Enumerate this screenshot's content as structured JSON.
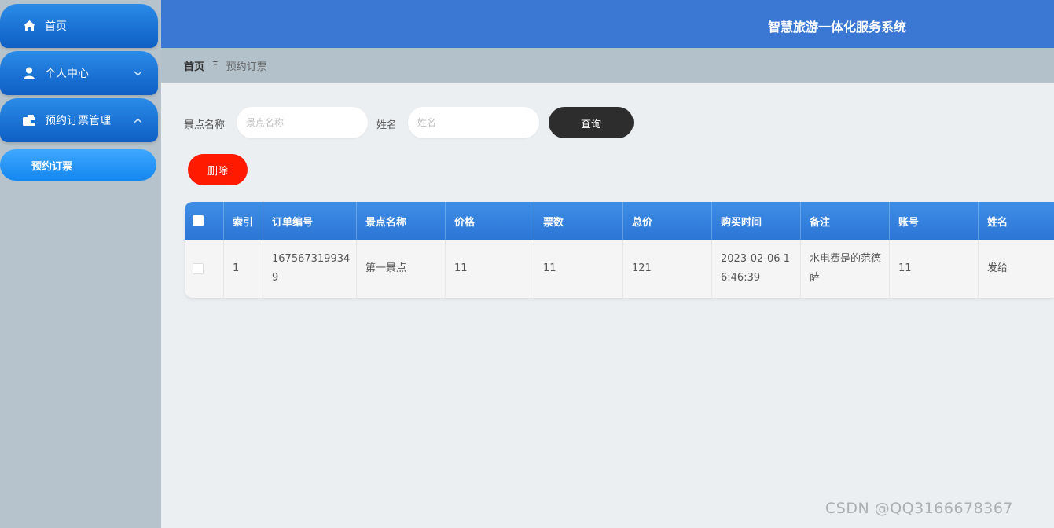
{
  "app": {
    "title": "智慧旅游一体化服务系统"
  },
  "sidebar": {
    "items": [
      {
        "label": "首页",
        "icon": "home-icon"
      },
      {
        "label": "个人中心",
        "icon": "user-icon",
        "arrow": "chevron-down-icon"
      },
      {
        "label": "预约订票管理",
        "icon": "wallet-icon",
        "arrow": "chevron-up-icon"
      }
    ],
    "subitems": [
      {
        "label": "预约订票"
      }
    ]
  },
  "breadcrumb": {
    "home": "首页",
    "separator": "Ξ",
    "current": "预约订票"
  },
  "search": {
    "spot_label": "景点名称",
    "spot_placeholder": "景点名称",
    "name_label": "姓名",
    "name_placeholder": "姓名",
    "query_button": "查询"
  },
  "actions": {
    "delete_button": "删除"
  },
  "table": {
    "columns": [
      "索引",
      "订单编号",
      "景点名称",
      "价格",
      "票数",
      "总价",
      "购买时间",
      "备注",
      "账号",
      "姓名"
    ],
    "rows": [
      [
        "1",
        "1675673199349",
        "第一景点",
        "11",
        "11",
        "121",
        "2023-02-06 16:46:39",
        "水电费是的范德萨",
        "11",
        "发给"
      ]
    ]
  },
  "watermark": "CSDN @QQ3166678367",
  "colors": {
    "header_bg": "#3b78d4",
    "menu_accent": "#1a6fd6",
    "query_button": "#2d2d2d",
    "delete_button": "#ff1a00"
  }
}
